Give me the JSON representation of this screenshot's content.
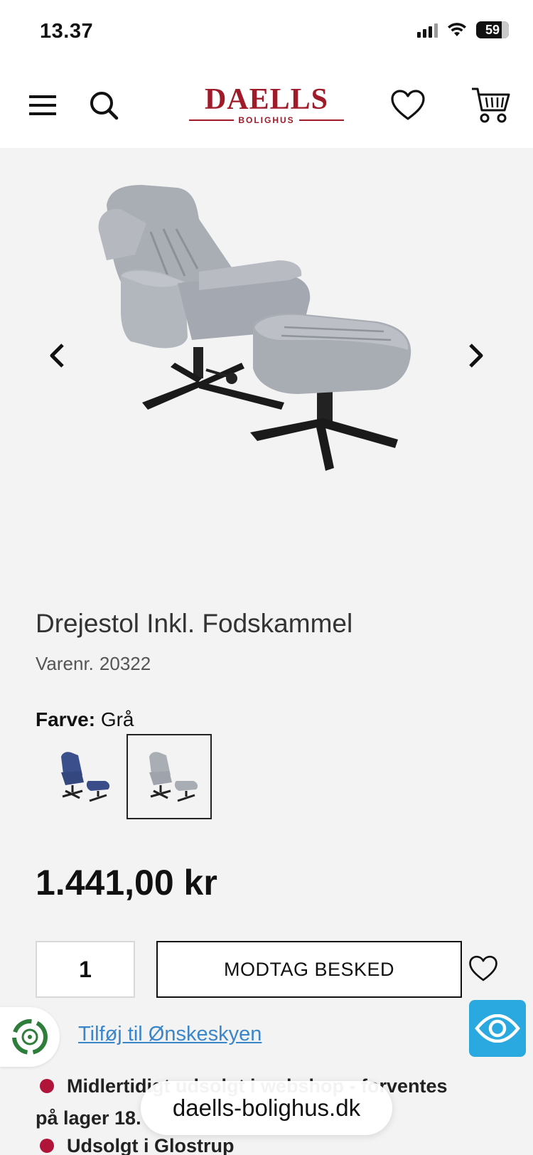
{
  "status": {
    "time": "13.37",
    "battery": "59"
  },
  "header": {
    "logo_main": "DAELLS",
    "logo_sub": "BOLIGHUS"
  },
  "product": {
    "title": "Drejestol Inkl. Fodskammel",
    "sku_label": "Varenr.",
    "sku": "20322",
    "color_label": "Farve:",
    "color_value": "Grå",
    "price": "1.441,00 kr",
    "quantity": "1",
    "notify_button": "MODTAG BESKED",
    "wishlist_link": "Tilføj til Ønskeskyen"
  },
  "stock": {
    "line1": "Midlertidigt udsolgt i webshop - forventes",
    "line2": "på lager 18.",
    "line3": "Udsolgt i Glostrup"
  },
  "browser": {
    "url": "daells-bolighus.dk"
  },
  "colors": {
    "brand": "#a01b2a",
    "link": "#3a86c8",
    "stock_dot": "#b01438",
    "eye_badge": "#2aa9e0"
  }
}
